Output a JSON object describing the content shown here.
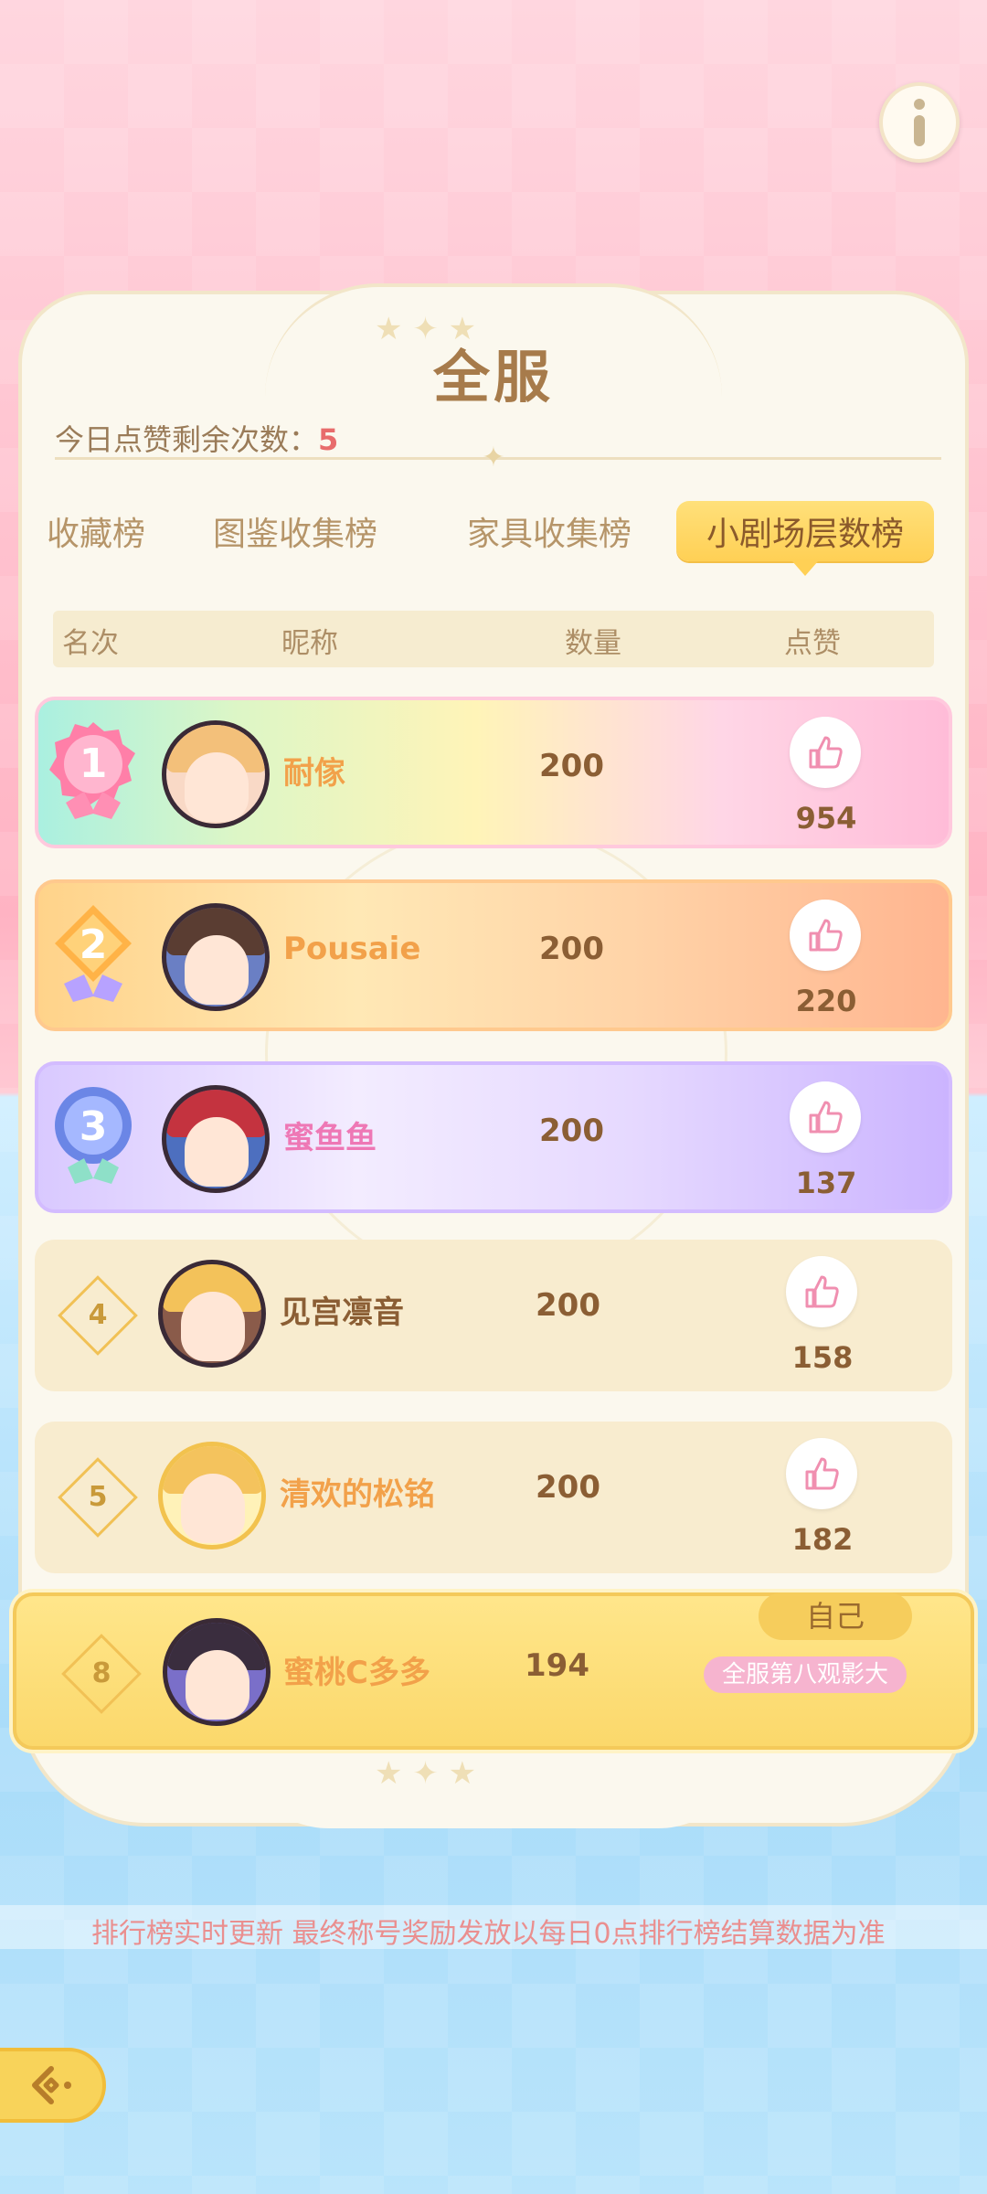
{
  "header": {
    "title": "全服",
    "likes_remaining_label": "今日点赞剩余次数：",
    "likes_remaining_value": "5"
  },
  "tabs": [
    {
      "label": "收藏榜",
      "active": false
    },
    {
      "label": "图鉴收集榜",
      "active": false
    },
    {
      "label": "家具收集榜",
      "active": false
    },
    {
      "label": "小剧场层数榜",
      "active": true
    }
  ],
  "columns": {
    "rank": "名次",
    "nickname": "昵称",
    "quantity": "数量",
    "likes": "点赞"
  },
  "rows": [
    {
      "rank": "1",
      "nickname": "耐傢",
      "quantity": "200",
      "likes": "954"
    },
    {
      "rank": "2",
      "nickname": "Pousaie",
      "quantity": "200",
      "likes": "220"
    },
    {
      "rank": "3",
      "nickname": "蜜鱼鱼",
      "quantity": "200",
      "likes": "137"
    },
    {
      "rank": "4",
      "nickname": "见宫凛音",
      "quantity": "200",
      "likes": "158"
    },
    {
      "rank": "5",
      "nickname": "清欢的松铭",
      "quantity": "200",
      "likes": "182"
    }
  ],
  "self": {
    "rank": "8",
    "nickname": "蜜桃C多多",
    "quantity": "194",
    "tag": "自己",
    "title": "全服第八观影大"
  },
  "ticker": "排行榜实时更新 最终称号奖励发放以每日0点排行榜结算数据为准",
  "colors": {
    "accent": "#ffd055",
    "like_pink": "#f08fb0",
    "text_brown": "#8b5e34"
  },
  "icons": {
    "info": "info-icon",
    "like": "thumbs-up-icon",
    "back": "back-arrow-icon"
  }
}
